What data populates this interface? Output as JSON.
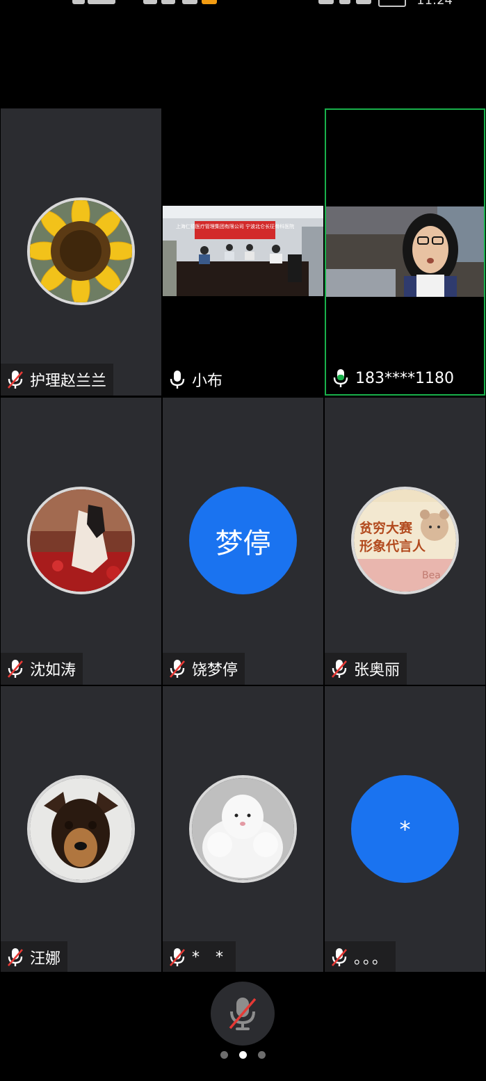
{
  "status_bar": {
    "time": "11:24"
  },
  "participants": [
    {
      "name": "护理赵兰兰",
      "mic": "muted",
      "avatar": "sunflower-photo"
    },
    {
      "name": "小布",
      "mic": "on",
      "avatar": "video-meeting-room"
    },
    {
      "name": "183****1180",
      "mic": "active",
      "avatar": "video-webcam-girl",
      "speaking": true
    },
    {
      "name": "沈如涛",
      "mic": "muted",
      "avatar": "painting-photo"
    },
    {
      "name": "饶梦停",
      "mic": "muted",
      "avatar_text": "梦停",
      "avatar_color": "#1a73f0"
    },
    {
      "name": "张奥丽",
      "mic": "muted",
      "avatar": "cartoon-bear-sticker"
    },
    {
      "name": "汪娜",
      "mic": "muted",
      "avatar": "dog-photo"
    },
    {
      "name": "* *",
      "mic": "muted",
      "avatar": "plush-sheep-photo"
    },
    {
      "name": "。。。",
      "mic": "muted",
      "avatar_text": "*",
      "avatar_color": "#1a73f0"
    }
  ],
  "video_banner_text": "上海仁德医疗管理集团有限公司 宁波北仑长征骨科医院",
  "sticker_text": {
    "line1": "贫穷大赛",
    "line2": "形象代言人",
    "tag": "Bea"
  },
  "pager": {
    "pages": 3,
    "current": 2
  },
  "colors": {
    "accent": "#1a73f0",
    "speaking_border": "#19b14b",
    "muted_slash": "#e53935"
  }
}
